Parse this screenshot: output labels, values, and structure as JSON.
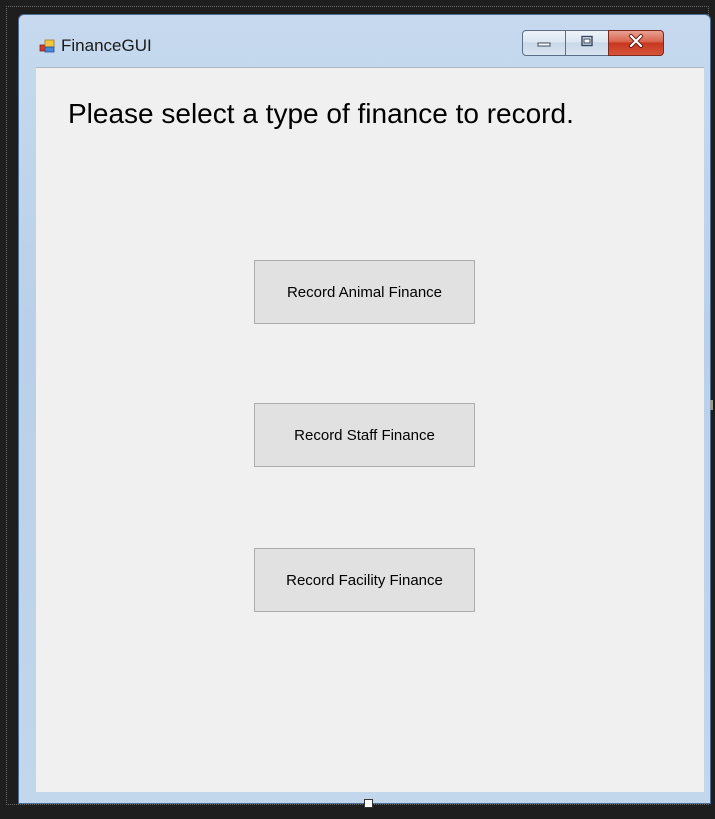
{
  "window": {
    "title": "FinanceGUI",
    "icon": "windows-form-icon"
  },
  "caption_buttons": {
    "minimize_icon": "minimize-icon",
    "maximize_icon": "maximize-icon",
    "close_icon": "close-icon",
    "close_color": "#c8361f"
  },
  "main": {
    "prompt": "Please select a type of finance to record.",
    "buttons": [
      {
        "label": "Record Animal Finance"
      },
      {
        "label": "Record Staff Finance"
      },
      {
        "label": "Record Facility Finance"
      }
    ]
  }
}
